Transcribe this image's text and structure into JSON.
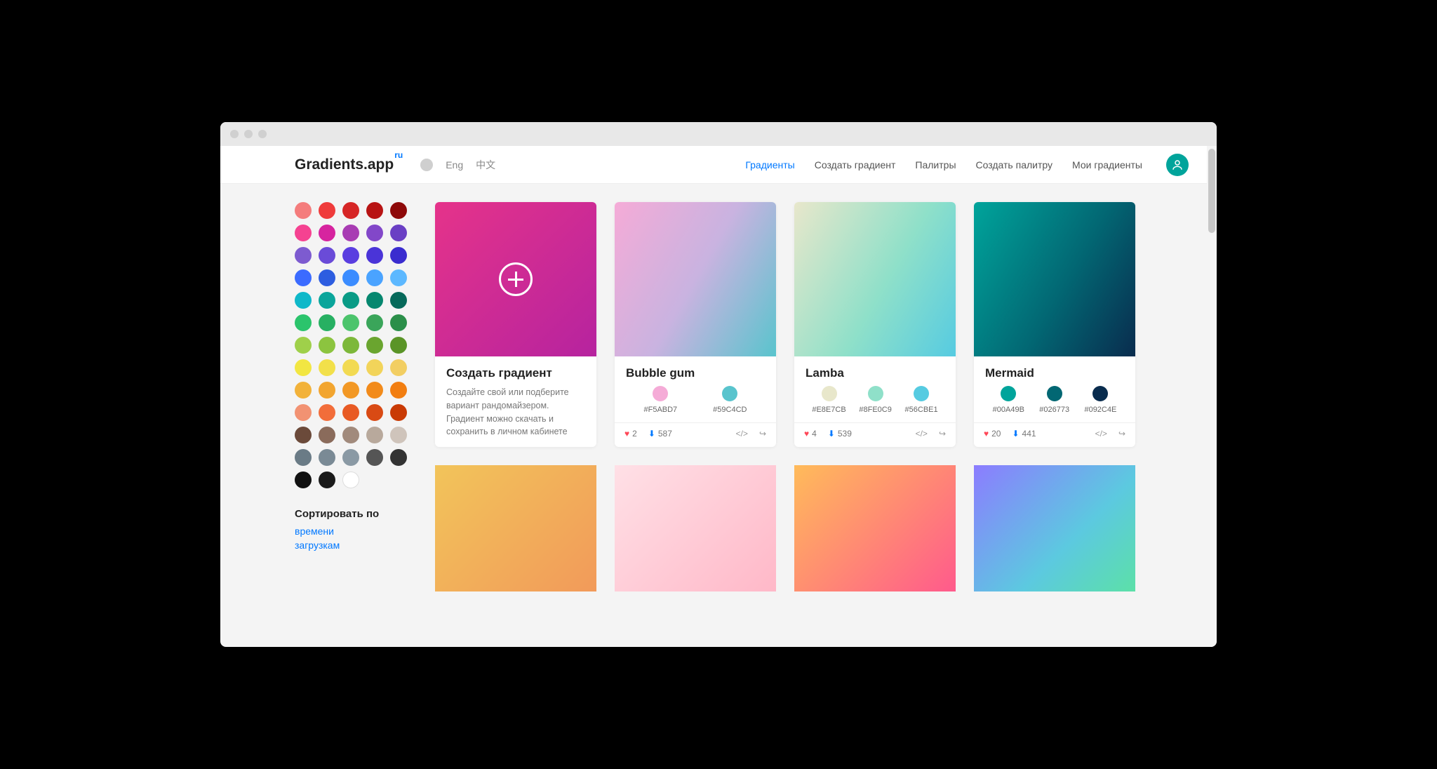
{
  "logo": {
    "text": "Gradients.app",
    "sup": "ru"
  },
  "langs": {
    "eng": "Eng",
    "zh": "中文"
  },
  "nav": {
    "gradients": "Градиенты",
    "create_gradient": "Создать градиент",
    "palettes": "Палитры",
    "create_palette": "Создать палитру",
    "my_gradients": "Мои градиенты"
  },
  "sidebar": {
    "swatches": [
      "#f47c7c",
      "#ef3b3b",
      "#d62626",
      "#b81414",
      "#8e0909",
      "#f54291",
      "#d6249f",
      "#a83cb3",
      "#8247c9",
      "#6a3fc4",
      "#7d5bd0",
      "#6a4bd8",
      "#5a3ee0",
      "#4a34d8",
      "#3a2ccf",
      "#3b6bff",
      "#2d5de0",
      "#3b8cff",
      "#4aa3ff",
      "#5cb8ff",
      "#0fb8c9",
      "#0aa59b",
      "#0a9b86",
      "#06876f",
      "#06695a",
      "#2bc46c",
      "#27b062",
      "#4cc46c",
      "#3aa55a",
      "#2b8f4a",
      "#9fd04a",
      "#8cc43f",
      "#7db83a",
      "#6aa52f",
      "#5a9427",
      "#f2e642",
      "#f2e04a",
      "#f2da52",
      "#f2d45a",
      "#f2ce62",
      "#f2b23a",
      "#f2a52f",
      "#f29825",
      "#f28b1b",
      "#f27e11",
      "#f29272",
      "#f26d3a",
      "#e85a24",
      "#d94a14",
      "#c93a04",
      "#6b4a3a",
      "#8a6b5b",
      "#a18a7c",
      "#b8a99c",
      "#cfc4bb",
      "#6a7b86",
      "#7a8a95",
      "#8a99a4",
      "#555555",
      "#333333",
      "#111111",
      "#1a1a1a",
      "#ffffff"
    ],
    "sort_title": "Сортировать по",
    "sort_time": "времени",
    "sort_downloads": "загрузкам"
  },
  "cards": {
    "create": {
      "title": "Создать градиент",
      "desc": "Создайте свой или подберите вариант рандомайзером. Градиент можно скачать и сохранить в личном кабинете",
      "bg": "linear-gradient(135deg,#e5338a 0%,#b6239f 100%)"
    },
    "list": [
      {
        "name": "Bubble gum",
        "bg": "linear-gradient(120deg,#f5abd7 0%,#c9b3e0 50%,#59c4cd 100%)",
        "colors": [
          {
            "hex": "#F5ABD7",
            "dot": "#f5abd7"
          },
          {
            "hex": "#59C4CD",
            "dot": "#59c4cd"
          }
        ],
        "likes": "2",
        "downloads": "587"
      },
      {
        "name": "Lamba",
        "bg": "linear-gradient(120deg,#e8e7cb 0%,#8fe0c9 55%,#56cbe1 100%)",
        "colors": [
          {
            "hex": "#E8E7CB",
            "dot": "#e8e7cb"
          },
          {
            "hex": "#8FE0C9",
            "dot": "#8fe0c9"
          },
          {
            "hex": "#56CBE1",
            "dot": "#56cbe1"
          }
        ],
        "likes": "4",
        "downloads": "539"
      },
      {
        "name": "Mermaid",
        "bg": "linear-gradient(120deg,#00a49b 0%,#026773 55%,#092c4e 100%)",
        "colors": [
          {
            "hex": "#00A49B",
            "dot": "#00a49b"
          },
          {
            "hex": "#026773",
            "dot": "#026773"
          },
          {
            "hex": "#092C4E",
            "dot": "#092c4e"
          }
        ],
        "likes": "20",
        "downloads": "441"
      }
    ],
    "row2": [
      "linear-gradient(135deg,#f2c45a 0%,#f29a5a 100%)",
      "linear-gradient(135deg,#ffe0e6 0%,#ffb8c8 100%)",
      "linear-gradient(135deg,#ffbb5a 0%,#ff5a8c 100%)",
      "linear-gradient(135deg,#8c7cff 0%,#5cc9e0 60%,#5ce0a8 100%)"
    ]
  }
}
